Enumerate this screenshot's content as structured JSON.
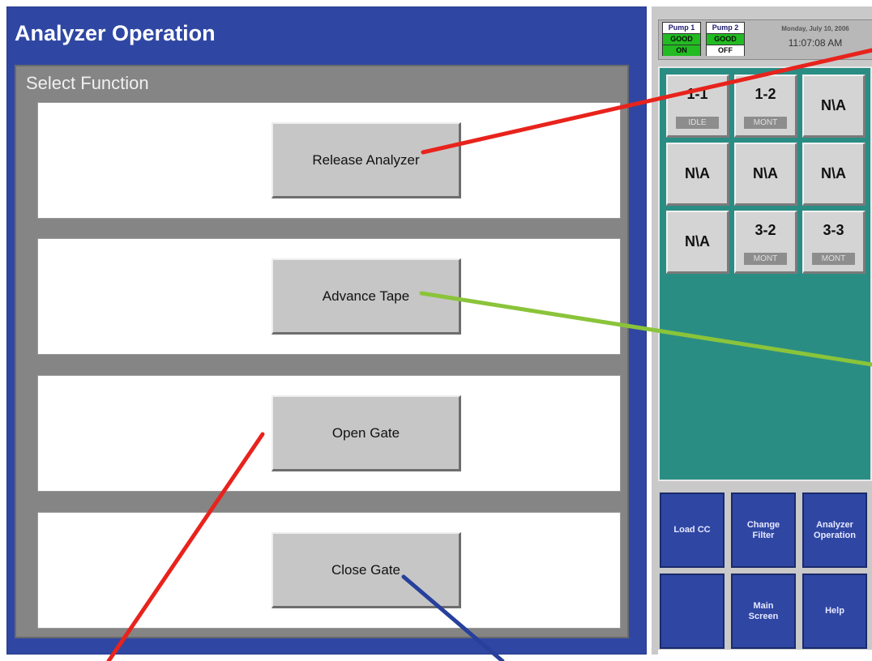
{
  "window": {
    "title": "Analyzer Operation"
  },
  "main": {
    "section_label": "Select Function",
    "buttons": [
      "Release Analyzer",
      "Advance Tape",
      "Open Gate",
      "Close Gate"
    ]
  },
  "status": {
    "pump1": {
      "name": "Pump 1",
      "state": "GOOD",
      "run": "ON"
    },
    "pump2": {
      "name": "Pump 2",
      "state": "GOOD",
      "run": "OFF"
    },
    "date": "Monday, July 10, 2006",
    "time": "11:07:08 AM"
  },
  "grid": {
    "cells": [
      {
        "label": "1-1",
        "status": "IDLE"
      },
      {
        "label": "1-2",
        "status": "MONT"
      },
      {
        "label": "N\\A",
        "status": ""
      },
      {
        "label": "N\\A",
        "status": ""
      },
      {
        "label": "N\\A",
        "status": ""
      },
      {
        "label": "N\\A",
        "status": ""
      },
      {
        "label": "N\\A",
        "status": ""
      },
      {
        "label": "3-2",
        "status": "MONT"
      },
      {
        "label": "3-3",
        "status": "MONT"
      }
    ]
  },
  "nav": {
    "buttons": [
      "Load CC",
      "Change\nFilter",
      "Analyzer\nOperation",
      "",
      "Main\nScreen",
      "Help"
    ]
  },
  "colors": {
    "panel_blue": "#2f47a3",
    "teal": "#2a8d84",
    "status_good": "#22bb22",
    "callout_red": "#e8231c",
    "callout_green": "#8ac43a",
    "callout_blue": "#27409c"
  }
}
